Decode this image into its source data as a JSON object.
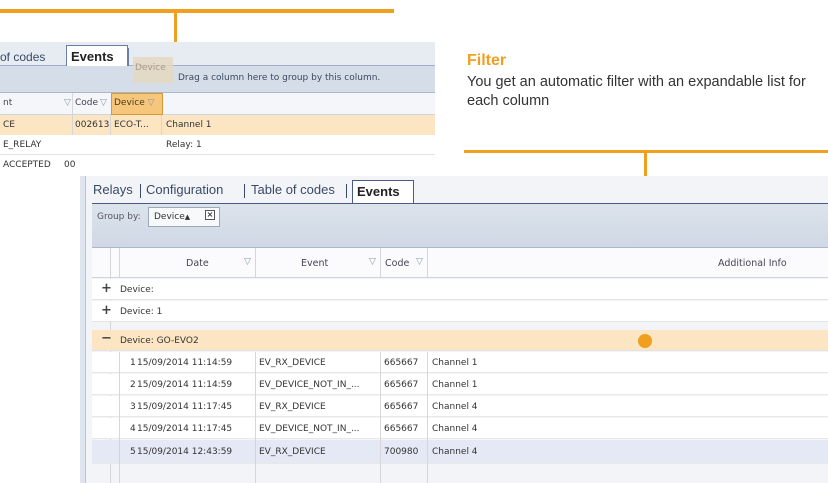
{
  "back_panel": {
    "tab_codes": "of codes",
    "tab_events": "Events",
    "drag_hint": "Drag a column here to group by this column.",
    "dragged_column": "Device",
    "columns": {
      "c0": "nt",
      "code": "Code",
      "device": "Device"
    },
    "rows": [
      {
        "c0": "CE",
        "code": "002613",
        "device": "ECO-T...",
        "info": "Channel 1"
      },
      {
        "c0": "E_RELAY",
        "code": "",
        "device": "",
        "info": "Relay: 1"
      },
      {
        "c0": "ACCEPTED",
        "code": "00"
      }
    ]
  },
  "callout": {
    "title": "Filter",
    "body": "You get an automatic filter with an expandable list for each column"
  },
  "front_panel": {
    "tabs": [
      "Relays",
      "Configuration",
      "Table of codes",
      "Events"
    ],
    "group_by_label": "Group by:",
    "group_chip": "Device",
    "columns": {
      "date": "Date",
      "event": "Event",
      "code": "Code",
      "info": "Additional Info"
    },
    "groups": [
      {
        "sign": "+",
        "label": "Device:"
      },
      {
        "sign": "+",
        "label": "Device: 1"
      },
      {
        "sign": "−",
        "label": "Device: GO-EVO2"
      }
    ],
    "rows": [
      {
        "n": "1",
        "date": "15/09/2014 11:14:59",
        "event": "EV_RX_DEVICE",
        "code": "665667",
        "info": "Channel 1"
      },
      {
        "n": "2",
        "date": "15/09/2014 11:14:59",
        "event": "EV_DEVICE_NOT_IN_...",
        "code": "665667",
        "info": "Channel 1"
      },
      {
        "n": "3",
        "date": "15/09/2014 11:17:45",
        "event": "EV_RX_DEVICE",
        "code": "665667",
        "info": "Channel 4"
      },
      {
        "n": "4",
        "date": "15/09/2014 11:17:45",
        "event": "EV_DEVICE_NOT_IN_...",
        "code": "665667",
        "info": "Channel 4"
      },
      {
        "n": "5",
        "date": "15/09/2014 12:43:59",
        "event": "EV_RX_DEVICE",
        "code": "700980",
        "info": "Channel 4"
      }
    ]
  },
  "icons": {
    "filter": "filter-icon",
    "remove": "close-icon",
    "sort": "sort-up-icon"
  },
  "colors": {
    "accent": "#f0a01e",
    "highlight": "#fce5c3",
    "selected_header": "#f6c77b"
  }
}
